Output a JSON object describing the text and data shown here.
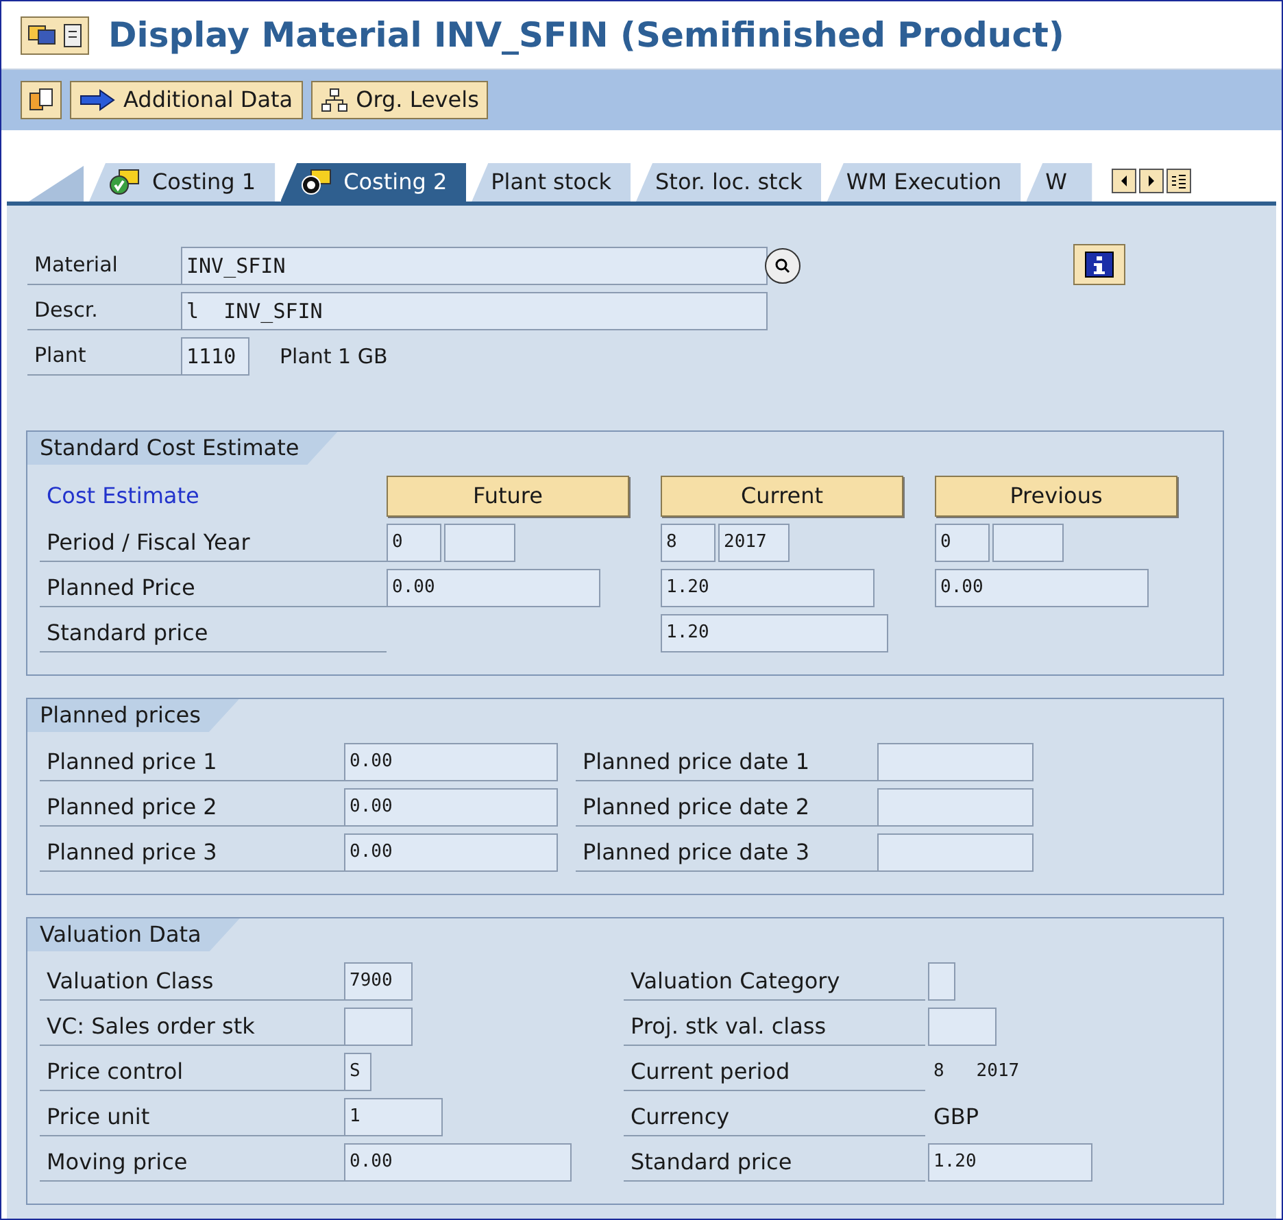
{
  "window": {
    "title": "Display Material INV_SFIN (Semifinished Product)"
  },
  "toolbar": {
    "buttons": [
      {
        "label": "Additional Data",
        "kind": "arrow"
      },
      {
        "label": "Org. Levels",
        "kind": "tree"
      }
    ]
  },
  "tabs": [
    {
      "label": "Costing 1",
      "selected": false,
      "kind": "check"
    },
    {
      "label": "Costing 2",
      "selected": true,
      "kind": "coins"
    },
    {
      "label": "Plant stock",
      "selected": false
    },
    {
      "label": "Stor. loc. stck",
      "selected": false
    },
    {
      "label": "WM Execution",
      "selected": false
    },
    {
      "label": "W",
      "selected": false
    }
  ],
  "header": {
    "fields": [
      {
        "label": "Material",
        "value": "INV_SFIN",
        "kind": "search"
      },
      {
        "label": "Descr.",
        "value": "l  INV_SFIN",
        "kind": "text"
      },
      {
        "label": "Plant",
        "value": "1110",
        "text": "Plant 1 GB",
        "kind": "code"
      }
    ]
  },
  "standard_cost_estimate": {
    "title": "Standard Cost Estimate",
    "link": "Cost Estimate",
    "buttons": [
      "Future",
      "Current",
      "Previous"
    ],
    "rows": [
      {
        "label": "Period / Fiscal Year",
        "kind": "period",
        "cells": [
          {
            "period": "0"
          },
          {
            "period": "8",
            "year": "2017"
          },
          {
            "period": "0"
          }
        ]
      },
      {
        "label": "Planned Price",
        "kind": "price",
        "values": [
          "0.00",
          "1.20",
          "0.00"
        ]
      },
      {
        "label": "Standard price",
        "kind": "current_only",
        "value": "1.20"
      }
    ]
  },
  "planned_prices": {
    "title": "Planned prices",
    "rows": [
      {
        "label": "Planned price 1",
        "value": "0.00",
        "date_label": "Planned price date 1"
      },
      {
        "label": "Planned price 2",
        "value": "0.00",
        "date_label": "Planned price date 2"
      },
      {
        "label": "Planned price 3",
        "value": "0.00",
        "date_label": "Planned price date 3"
      }
    ]
  },
  "valuation_data": {
    "title": "Valuation Data",
    "left": [
      {
        "label": "Valuation Class",
        "value": "7900"
      },
      {
        "label": "VC: Sales order stk"
      },
      {
        "label": "Price control",
        "value": "S"
      },
      {
        "label": "Price unit",
        "value": "1"
      },
      {
        "label": "Moving price",
        "value": "0.00"
      }
    ],
    "right": [
      {
        "label": "Valuation Category",
        "kind": "field"
      },
      {
        "label": "Proj. stk val. class",
        "kind": "field"
      },
      {
        "label": "Current period",
        "kind": "text",
        "value": "8   2017"
      },
      {
        "label": "Currency",
        "kind": "text",
        "value": "GBP"
      },
      {
        "label": "Standard price",
        "kind": "field",
        "value": "1.20"
      }
    ]
  }
}
